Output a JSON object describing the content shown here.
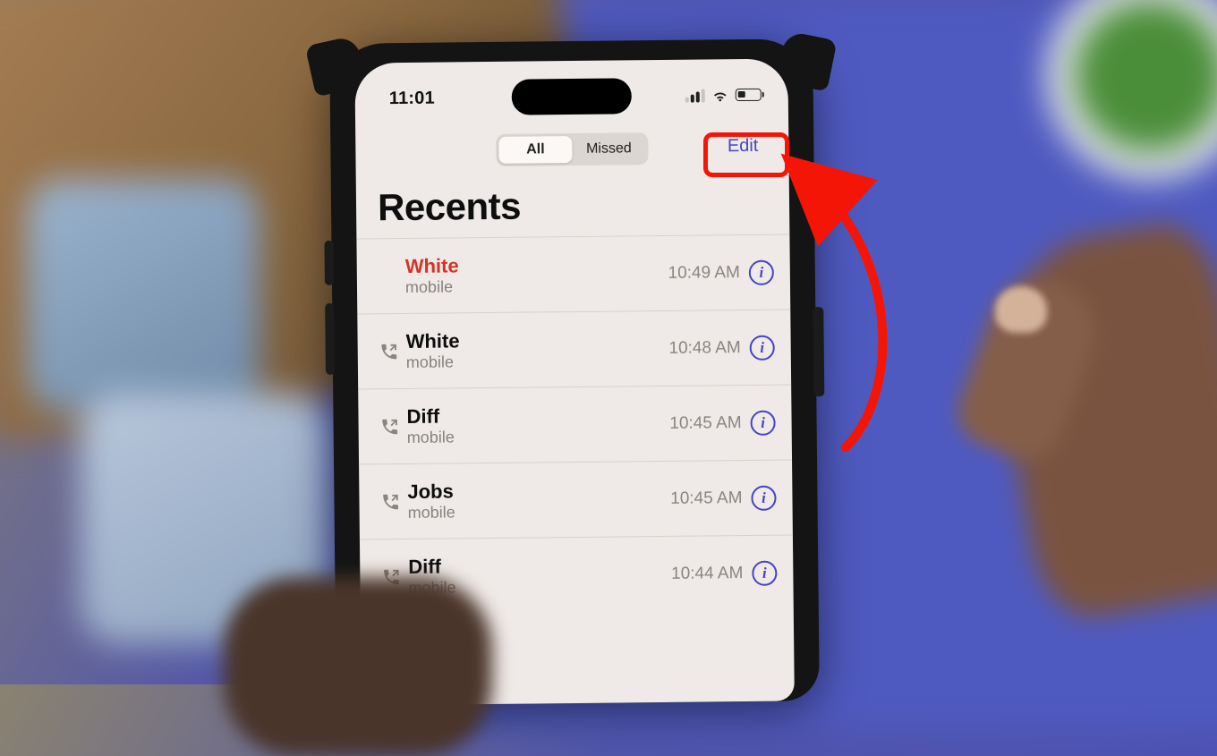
{
  "status": {
    "time": "11:01"
  },
  "nav": {
    "segments": {
      "all": "All",
      "missed": "Missed"
    },
    "edit": "Edit"
  },
  "title": "Recents",
  "calls": [
    {
      "name": "White",
      "sub": "mobile",
      "time": "10:49 AM",
      "missed": true,
      "outgoing": false
    },
    {
      "name": "White",
      "sub": "mobile",
      "time": "10:48 AM",
      "missed": false,
      "outgoing": true
    },
    {
      "name": "Diff",
      "sub": "mobile",
      "time": "10:45 AM",
      "missed": false,
      "outgoing": true
    },
    {
      "name": "Jobs",
      "sub": "mobile",
      "time": "10:45 AM",
      "missed": false,
      "outgoing": true
    },
    {
      "name": "Diff",
      "sub": "mobile",
      "time": "10:44 AM",
      "missed": false,
      "outgoing": true
    }
  ],
  "annotation": {
    "highlight": "edit-button",
    "arrow_to": "edit-button"
  }
}
